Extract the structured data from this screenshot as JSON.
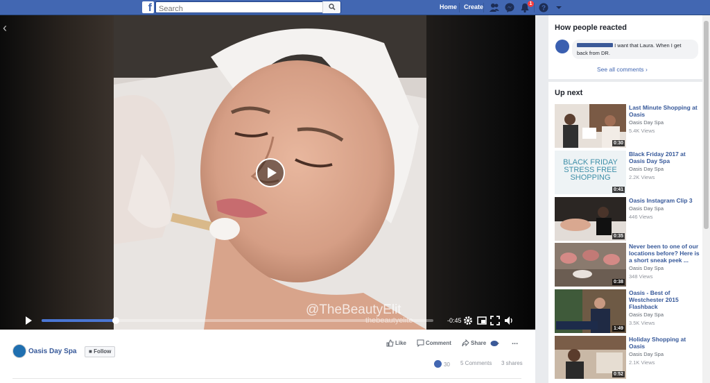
{
  "topbar": {
    "search_placeholder": "Search",
    "home": "Home",
    "create": "Create",
    "notification_count": "1"
  },
  "video": {
    "watermark": "@TheBeautyElit",
    "watermark_handle": "thebeautyelite",
    "time_remaining": "-0:45",
    "progress_fraction": 0.19
  },
  "post": {
    "page_name": "Oasis Day Spa",
    "follow": "Follow",
    "like": "Like",
    "comment": "Comment",
    "share": "Share",
    "more": "...",
    "reactions_count": "30",
    "comments_count": "5 Comments",
    "shares_count": "3 shares"
  },
  "reactions": {
    "title": "How people reacted",
    "comment_text": "I want that Laura. When I get back from DR.",
    "see_all": "See all comments"
  },
  "upnext": {
    "title": "Up next",
    "items": [
      {
        "title": "Last Minute Shopping at Oasis",
        "channel": "Oasis Day Spa",
        "views": "5.4K Views",
        "duration": "0:30"
      },
      {
        "title": "Black Friday 2017 at Oasis Day Spa",
        "channel": "Oasis Day Spa",
        "views": "2.2K Views",
        "duration": "0:41",
        "thumb_text": [
          "BLACK FRIDAY",
          "STRESS FREE",
          "SHOPPING"
        ]
      },
      {
        "title": "Oasis Instagram Clip 3",
        "channel": "Oasis Day Spa",
        "views": "446 Views",
        "duration": "0:35"
      },
      {
        "title": "Never been to one of our locations before? Here is a short sneak peek ...",
        "channel": "Oasis Day Spa",
        "views": "348 Views",
        "duration": "0:38"
      },
      {
        "title": "Oasis - Best of Westchester 2015 Flashback",
        "channel": "Oasis Day Spa",
        "views": "3.5K Views",
        "duration": "1:49"
      },
      {
        "title": "Holiday Shopping at Oasis",
        "channel": "Oasis Day Spa",
        "views": "2.1K Views",
        "duration": "0:52"
      }
    ]
  },
  "colors": {
    "brand_blue": "#4267b2",
    "link_blue": "#365899",
    "progress_blue": "#4a76d4"
  }
}
